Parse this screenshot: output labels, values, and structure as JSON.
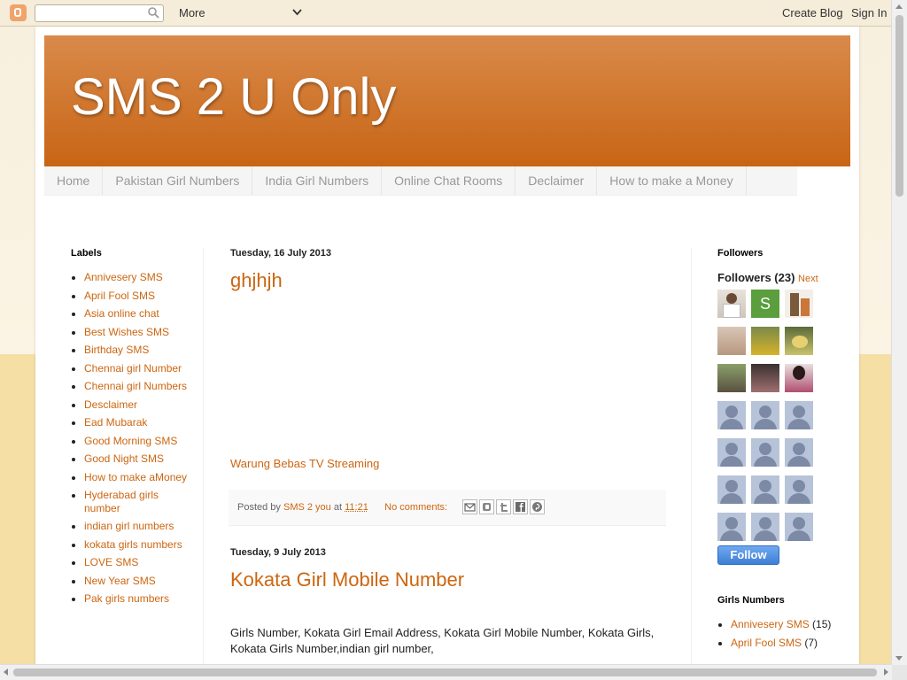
{
  "navbar": {
    "more_label": "More",
    "create_blog_label": "Create Blog",
    "sign_in_label": "Sign In"
  },
  "header": {
    "title": "SMS 2 U Only"
  },
  "tabs": [
    {
      "label": "Home"
    },
    {
      "label": "Pakistan Girl Numbers"
    },
    {
      "label": "India Girl Numbers"
    },
    {
      "label": "Online Chat Rooms"
    },
    {
      "label": "Declaimer"
    },
    {
      "label": "How to make a Money"
    }
  ],
  "labels_widget": {
    "title": "Labels",
    "items": [
      "Annivesery SMS",
      "April Fool SMS",
      "Asia online chat",
      "Best Wishes SMS",
      "Birthday SMS",
      "Chennai girl Number",
      "Chennai girl Numbers",
      "Desclaimer",
      "Ead Mubarak",
      "Good Morning SMS",
      "Good Night SMS",
      "How to make aMoney",
      "Hyderabad girls number",
      "indian girl numbers",
      "kokata girls numbers",
      "LOVE SMS",
      "New Year SMS",
      "Pak girls numbers"
    ]
  },
  "posts": [
    {
      "date": "Tuesday, 16 July 2013",
      "title": "ghjhjh",
      "link_text": "Warung Bebas TV Streaming",
      "footer": {
        "posted_by_label": "Posted by",
        "author": "SMS 2 you",
        "at_label": "at",
        "time": "11:21",
        "comments": "No comments:"
      }
    },
    {
      "date": "Tuesday, 9 July 2013",
      "title": "Kokata Girl Mobile Number",
      "body": "Girls Number, Kokata Girl Email Address, Kokata Girl Mobile Number, Kokata Girls, Kokata Girls Number,indian girl number,"
    }
  ],
  "followers": {
    "title": "Followers",
    "heading": "Followers (23)",
    "next_label": "Next",
    "follow_label": "Follow"
  },
  "girls_numbers": {
    "title": "Girls Numbers",
    "items": [
      {
        "label": "Annivesery SMS",
        "count": "(15)"
      },
      {
        "label": "April Fool SMS",
        "count": "(7)"
      }
    ]
  },
  "colors": {
    "link": "#cc6611",
    "header_top": "#d98a4a",
    "header_bottom": "#c86515"
  }
}
